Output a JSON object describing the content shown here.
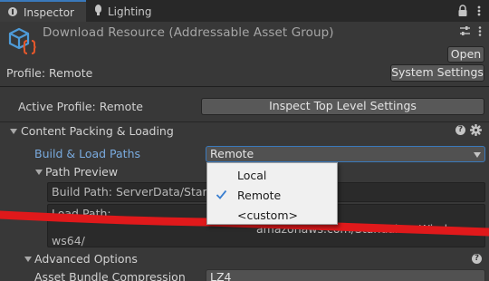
{
  "tabs": [
    {
      "label": "Inspector",
      "icon": "info-icon",
      "active": true
    },
    {
      "label": "Lighting",
      "icon": "lightbulb-icon",
      "active": false
    }
  ],
  "header": {
    "title": "Download Resource (Addressable Asset Group)",
    "open_label": "Open",
    "profile_label": "Profile: Remote",
    "system_settings_label": "System Settings"
  },
  "main": {
    "active_profile_label": "Active Profile: Remote",
    "inspect_button_label": "Inspect Top Level Settings",
    "content_section_label": "Content Packing & Loading",
    "build_paths_label": "Build & Load Paths",
    "build_paths_value": "Remote",
    "path_preview_label": "Path Preview",
    "build_path_text": "Build Path: ServerData/Standa",
    "load_path_text": "Load Path:",
    "load_path_overflow": "amazonaws.com/StandaloneWindo",
    "load_path_line2": "ws64/",
    "advanced_label": "Advanced Options",
    "compression_label": "Asset Bundle Compression",
    "compression_value": "LZ4"
  },
  "popup_menu": {
    "items": [
      {
        "label": "Local",
        "checked": false
      },
      {
        "label": "Remote",
        "checked": true
      },
      {
        "label": "<custom>",
        "checked": false
      }
    ]
  },
  "colors": {
    "accent": "#3a79bb",
    "link_label": "#7aabdf",
    "redaction": "#e0191b",
    "background": "#383838"
  }
}
